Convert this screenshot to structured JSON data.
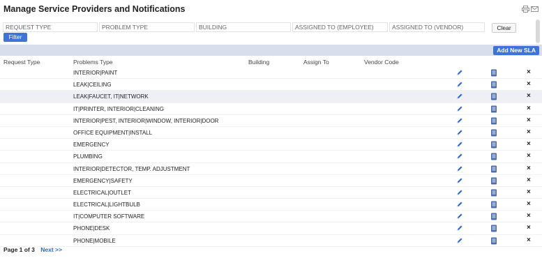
{
  "page": {
    "title": "Manage Service Providers and Notifications"
  },
  "header_icons": [
    "print-icon",
    "email-icon"
  ],
  "filters": {
    "request_type": "REQUEST TYPE",
    "problem_type": "PROBLEM TYPE",
    "building": "BUILDING",
    "assigned_employee": "ASSIGNED TO (EMPLOYEE)",
    "assigned_vendor": "ASSIGNED TO (VENDOR)",
    "clear_label": "Clear",
    "filter_label": "Filter"
  },
  "toolbar": {
    "add_label": "Add New SLA"
  },
  "columns": {
    "request_type": "Request Type",
    "problems_type": "Problems Type",
    "building": "Building",
    "assign_to": "Assign To",
    "vendor_code": "Vendor Code"
  },
  "rows": [
    "INTERIOR|PAINT",
    "LEAK|CEILING",
    "LEAK|FAUCET, IT|NETWORK",
    "IT|PRINTER, INTERIOR|CLEANING",
    "INTERIOR|PEST, INTERIOR|WINDOW, INTERIOR|DOOR",
    "OFFICE EQUIPMENT|INSTALL",
    "EMERGENCY",
    "PLUMBING",
    "INTERIOR|DETECTOR, TEMP. ADJUSTMENT",
    "EMERGENCY|SAFETY",
    "ELECTRICAL|OUTLET",
    "ELECTRICAL|LIGHTBULB",
    "IT|COMPUTER SOFTWARE",
    "PHONE|DESK",
    "PHONE|MOBILE"
  ],
  "highlighted_row": 2,
  "row_action_icons": {
    "edit": "pencil-icon",
    "details": "document-icon",
    "delete": "close-icon"
  },
  "pager": {
    "page_text": "Page 1 of 3",
    "next_label": "Next >>"
  },
  "colors": {
    "accent": "#3f73d8",
    "bar": "#d9deec",
    "icon": "#2f66c8"
  }
}
